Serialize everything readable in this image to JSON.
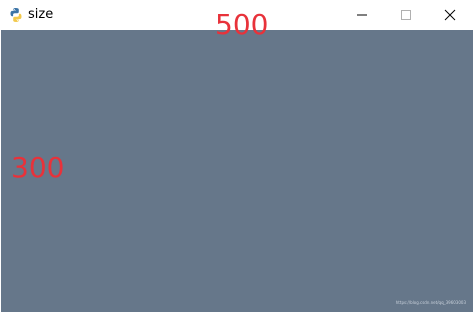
{
  "window": {
    "title": "size",
    "icon": "python-logo-icon",
    "controls": {
      "minimize": "minimize-icon",
      "maximize": "maximize-icon",
      "close": "close-icon"
    }
  },
  "client": {
    "width_label": "500",
    "height_label": "300",
    "watermark": "https://blog.csdn.net/qq_39603003"
  },
  "colors": {
    "client_bg": "#66778a",
    "label": "#e8323a"
  }
}
